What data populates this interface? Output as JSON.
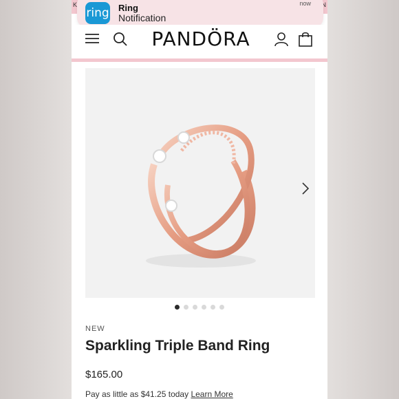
{
  "promo": {
    "left_fragment": "K",
    "right_fragment": "N"
  },
  "notification": {
    "app_name": "Ring",
    "message": "Notification",
    "time": "now",
    "icon_label": "ring"
  },
  "header": {
    "logo": "PANDÖRA",
    "icons": [
      "menu-icon",
      "search-icon",
      "account-icon",
      "bag-icon"
    ]
  },
  "gallery": {
    "image": "rose gold triple band ring",
    "dots_total": 6,
    "active_dot": 0
  },
  "product": {
    "badge": "NEW",
    "title": "Sparkling Triple Band Ring",
    "price": "$165.00",
    "installments_prefix": "Pay as little as $41.25 today",
    "learn_more": "Learn More"
  },
  "colors": {
    "accent_pink": "#f3c7cf",
    "ring_rose_gold": "#e7a88f",
    "notification_icon": "#1a98d5"
  }
}
